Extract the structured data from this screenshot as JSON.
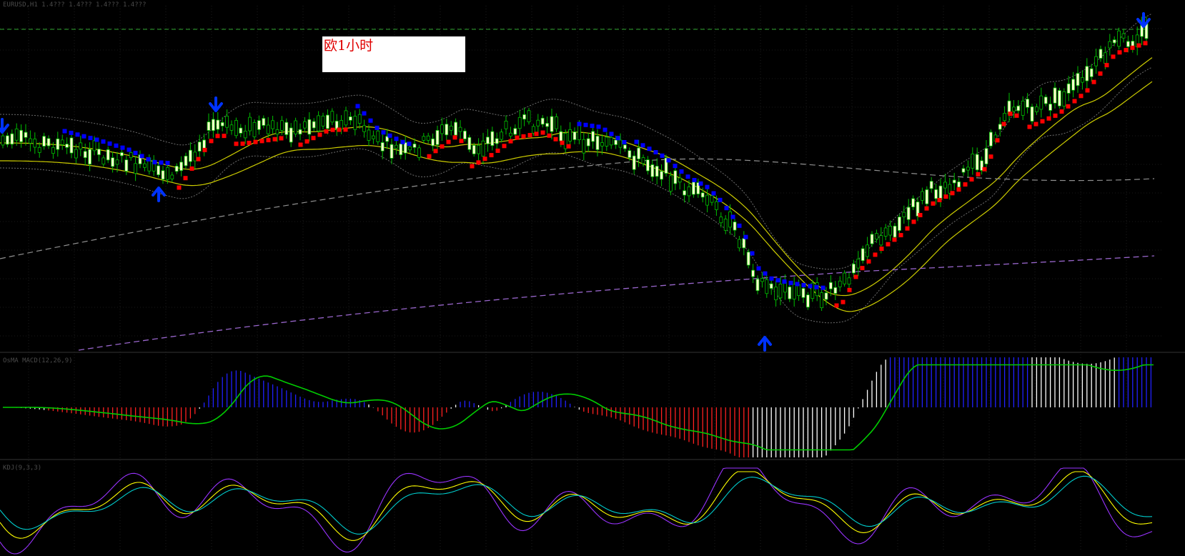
{
  "chart_data": {
    "type": "line",
    "title": "欧1小时",
    "panels": [
      {
        "name": "price",
        "indicators": [
          "candlesticks",
          "bollinger",
          "moving-averages",
          "parabolic-sar",
          "arrows"
        ]
      },
      {
        "name": "macd",
        "indicators": [
          "histogram",
          "signal-line"
        ]
      },
      {
        "name": "stochastic",
        "indicators": [
          "main",
          "signal",
          "fast"
        ]
      }
    ],
    "colors": {
      "background": "#000000",
      "candle_up": "#ffffcc",
      "candle_wick": "#00c000",
      "sar_up": "#ff0000",
      "sar_down": "#0000ff",
      "envelope": "#cccc00",
      "bollinger": "#808080",
      "long_ma": "#9966cc",
      "mid_ma": "#909090",
      "macd_pos": "#2020ff",
      "macd_neg": "#ff2020",
      "macd_flat": "#ffffff",
      "macd_signal": "#00cc00",
      "stoch_main": "#ffff00",
      "stoch_signal": "#00cccc",
      "stoch_fast": "#9933ff",
      "arrow": "#0033ff"
    }
  },
  "headers": {
    "price": "EURUSD,H1  1.4??? 1.4??? 1.4??? 1.4???",
    "macd": "OsMA MACD(12,26,9)",
    "stoch": "KDJ(9,3,3)"
  }
}
